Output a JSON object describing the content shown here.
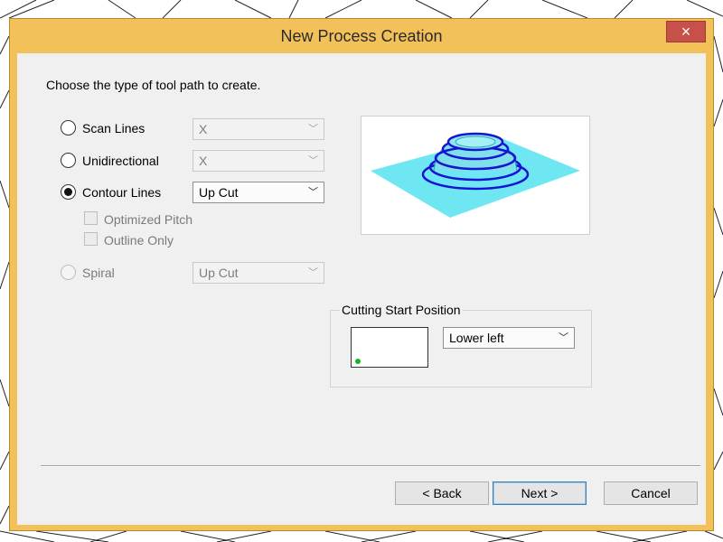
{
  "window": {
    "title": "New Process Creation",
    "close_icon": "×"
  },
  "prompt": "Choose the type of tool path to create.",
  "options": [
    {
      "label": "Scan Lines",
      "selected": false,
      "enabled": true,
      "dropdown_value": "X",
      "dropdown_enabled": false
    },
    {
      "label": "Unidirectional",
      "selected": false,
      "enabled": true,
      "dropdown_value": "X",
      "dropdown_enabled": false
    },
    {
      "label": "Contour Lines",
      "selected": true,
      "enabled": true,
      "dropdown_value": "Up Cut",
      "dropdown_enabled": true
    },
    {
      "label": "Spiral",
      "selected": false,
      "enabled": false,
      "dropdown_value": "Up Cut",
      "dropdown_enabled": false
    }
  ],
  "suboptions": [
    {
      "label": "Optimized Pitch",
      "checked": false,
      "enabled": false
    },
    {
      "label": "Outline Only",
      "checked": false,
      "enabled": false
    }
  ],
  "cutting_start": {
    "group_label": "Cutting Start Position",
    "value": "Lower left"
  },
  "buttons": {
    "back": "< Back",
    "next": "Next >",
    "cancel": "Cancel"
  },
  "colors": {
    "title_bar": "#f3c15a",
    "close_button": "#c7504a",
    "preview_surface": "#6fe7f3",
    "preview_contours": "#1414d2",
    "start_dot": "#1bb51b"
  },
  "icons": {
    "dropdown": "chevron-down-icon",
    "close": "close-icon"
  }
}
